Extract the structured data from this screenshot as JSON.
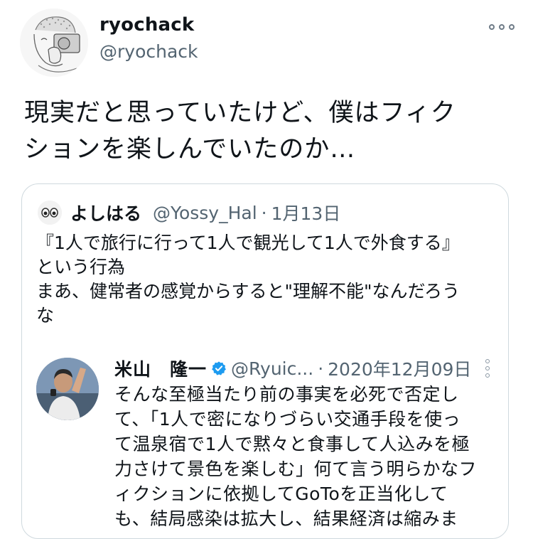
{
  "tweet": {
    "author": {
      "display_name": "ryochack",
      "handle": "@ryochack"
    },
    "text_lines": [
      "現実だと思っていたけど、僕はフィク",
      "ションを楽しんでいたのか…"
    ],
    "more_icon": "more-horizontal-icon"
  },
  "quoted": {
    "author": {
      "display_name": "よしはる",
      "handle": "@Yossy_Hal"
    },
    "separator": "·",
    "date": "1月13日",
    "text_lines": [
      "『1人で旅行に行って1人で観光して1人で外食する』",
      "という行為",
      "まあ、健常者の感覚からすると\"理解不能\"なんだろう",
      "な"
    ],
    "reply": {
      "author": {
        "display_name": "米山　隆一",
        "handle": "@Ryuic...",
        "verified_icon": "verified-badge-icon"
      },
      "separator": "·",
      "date": "2020年12月09日",
      "more_icon": "more-vertical-icon",
      "text_lines": [
        "そんな至極当たり前の事実を必死で否定し",
        "て、「1人で密になりづらい交通手段を使っ",
        "て温泉宿で1人で黙々と食事して人込みを極",
        "力さけて景色を楽しむ」何て言う明らかなフ",
        "ィクションに依拠してGoToを正当化して",
        "も、結局感染は拡大し、結果経済は縮みま"
      ]
    }
  },
  "colors": {
    "text": "#0f1419",
    "secondary": "#536471",
    "border": "#cfd9de",
    "verified": "#1d9bf0"
  }
}
